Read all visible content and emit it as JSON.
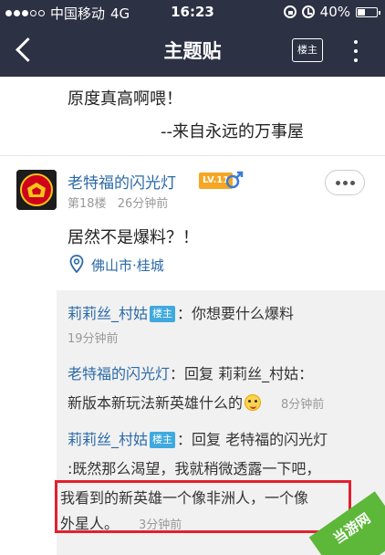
{
  "status_bar": {
    "carrier": "中国移动",
    "network": "4G",
    "time": "16:23",
    "battery": "40%",
    "battery_level": 0.4
  },
  "nav": {
    "title": "主题贴",
    "owner_button": "楼主"
  },
  "post_tail": {
    "line1": "原度真高啊喂！",
    "line2": "--来自永远的万事屋"
  },
  "floor": {
    "username": "老特福的闪光灯",
    "level": "LV.11",
    "floor_label": "第18楼",
    "time": "26分钟前",
    "content": "居然不是爆料？！",
    "location": "佛山市·桂城"
  },
  "replies": [
    {
      "name": "莉莉丝_村姑",
      "tag": "楼主",
      "text": "：你想要什么爆料",
      "time": "19分钟前"
    },
    {
      "name": "老特福的闪光灯",
      "text_prefix": "：回复 ",
      "reply_to": "莉莉丝_村姑",
      "text_suffix": "：",
      "line2": "新版本新玩法新英雄什么的",
      "time": "8分钟前"
    },
    {
      "name": "莉莉丝_村姑",
      "tag": "楼主",
      "text_prefix": "：回复 ",
      "reply_to": "老特福的闪光灯",
      "line2": ":既然那么渴望，我就稍微透露一下吧，",
      "line3": "我看到的新英雄一个像非洲人，一个像",
      "line4": "外星人。",
      "time": "3分钟前"
    }
  ],
  "watermark": {
    "text": "当游网"
  },
  "colors": {
    "header_bg": "#2c3143",
    "link_blue": "#2b6aa8",
    "owner_tag": "#3fa9e0",
    "level_badge": "#f5a623",
    "highlight_red": "#e2202f"
  }
}
